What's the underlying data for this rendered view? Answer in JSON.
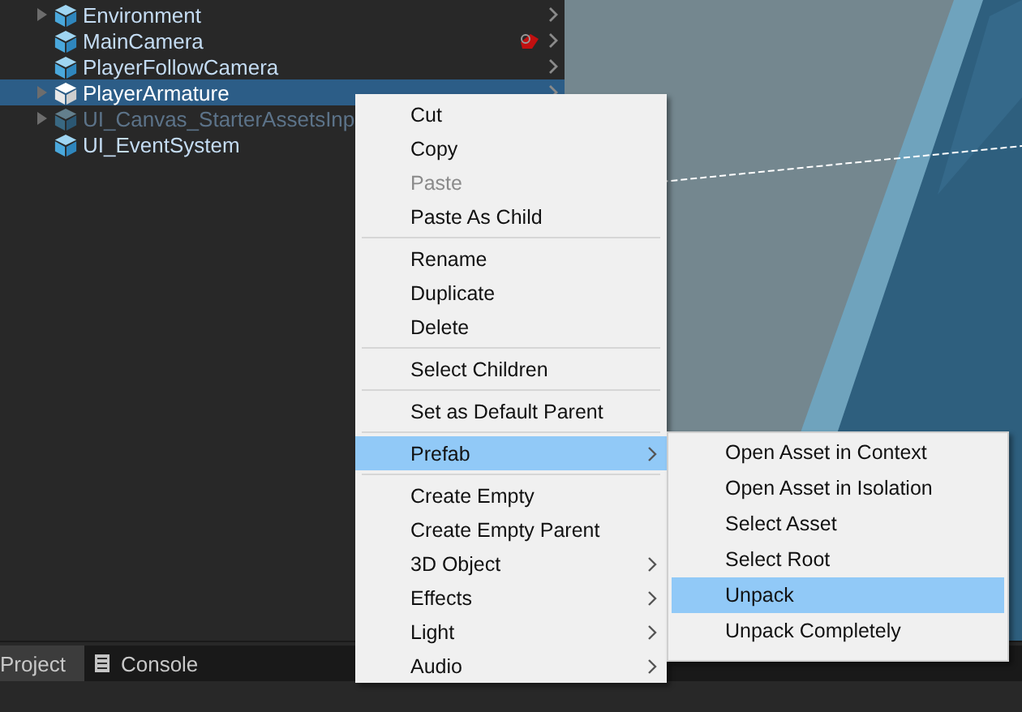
{
  "hierarchy": {
    "items": [
      {
        "name": "Environment",
        "expandable": true,
        "selected": false,
        "disabled": false,
        "chevron": true
      },
      {
        "name": "MainCamera",
        "expandable": false,
        "selected": false,
        "disabled": false,
        "badge": true,
        "chevron": true
      },
      {
        "name": "PlayerFollowCamera",
        "expandable": false,
        "selected": false,
        "disabled": false,
        "chevron": true
      },
      {
        "name": "PlayerArmature",
        "expandable": true,
        "selected": true,
        "disabled": false,
        "chevron": true
      },
      {
        "name": "UI_Canvas_StarterAssetsInp",
        "expandable": true,
        "selected": false,
        "disabled": true
      },
      {
        "name": "UI_EventSystem",
        "expandable": false,
        "selected": false,
        "disabled": false
      }
    ]
  },
  "bottom_panel": {
    "tabs": [
      {
        "label": "Project",
        "selected": true,
        "icon": false
      },
      {
        "label": "Console",
        "selected": false,
        "icon": true
      }
    ]
  },
  "context_menu": {
    "items": [
      {
        "kind": "item",
        "label": "Cut",
        "disabled": false,
        "selected": false,
        "submenu": false
      },
      {
        "kind": "item",
        "label": "Copy",
        "disabled": false,
        "selected": false,
        "submenu": false
      },
      {
        "kind": "item",
        "label": "Paste",
        "disabled": true,
        "selected": false,
        "submenu": false
      },
      {
        "kind": "item",
        "label": "Paste As Child",
        "disabled": false,
        "selected": false,
        "submenu": false
      },
      {
        "kind": "separator"
      },
      {
        "kind": "item",
        "label": "Rename",
        "disabled": false,
        "selected": false,
        "submenu": false
      },
      {
        "kind": "item",
        "label": "Duplicate",
        "disabled": false,
        "selected": false,
        "submenu": false
      },
      {
        "kind": "item",
        "label": "Delete",
        "disabled": false,
        "selected": false,
        "submenu": false
      },
      {
        "kind": "separator"
      },
      {
        "kind": "item",
        "label": "Select Children",
        "disabled": false,
        "selected": false,
        "submenu": false
      },
      {
        "kind": "separator"
      },
      {
        "kind": "item",
        "label": "Set as Default Parent",
        "disabled": false,
        "selected": false,
        "submenu": false
      },
      {
        "kind": "separator"
      },
      {
        "kind": "item",
        "label": "Prefab",
        "disabled": false,
        "selected": true,
        "submenu": true
      },
      {
        "kind": "separator"
      },
      {
        "kind": "item",
        "label": "Create Empty",
        "disabled": false,
        "selected": false,
        "submenu": false
      },
      {
        "kind": "item",
        "label": "Create Empty Parent",
        "disabled": false,
        "selected": false,
        "submenu": false
      },
      {
        "kind": "item",
        "label": "3D Object",
        "disabled": false,
        "selected": false,
        "submenu": true
      },
      {
        "kind": "item",
        "label": "Effects",
        "disabled": false,
        "selected": false,
        "submenu": true
      },
      {
        "kind": "item",
        "label": "Light",
        "disabled": false,
        "selected": false,
        "submenu": true
      },
      {
        "kind": "item",
        "label": "Audio",
        "disabled": false,
        "selected": false,
        "submenu": true
      }
    ]
  },
  "prefab_submenu": {
    "items": [
      {
        "label": "Open Asset in Context",
        "selected": false
      },
      {
        "label": "Open Asset in Isolation",
        "selected": false
      },
      {
        "label": "Select Asset",
        "selected": false
      },
      {
        "label": "Select Root",
        "selected": false
      },
      {
        "label": "Unpack",
        "selected": true
      },
      {
        "label": "Unpack Completely",
        "selected": false
      }
    ]
  }
}
